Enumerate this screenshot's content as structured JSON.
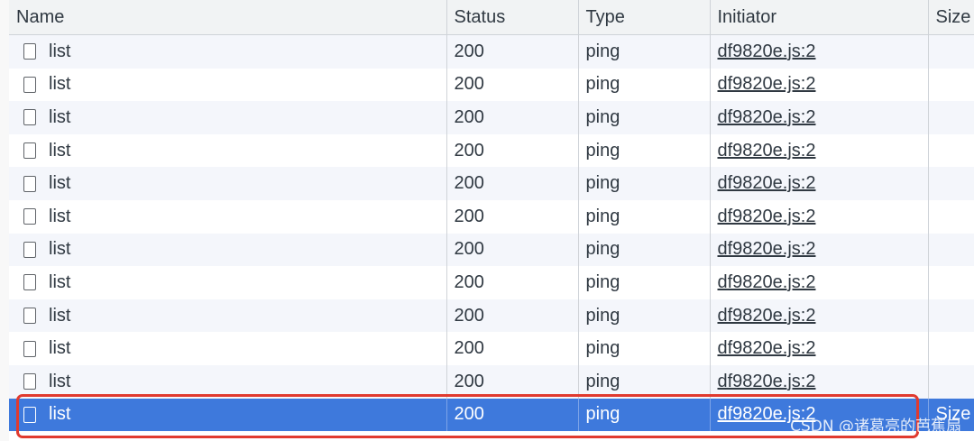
{
  "columns": {
    "name": "Name",
    "status": "Status",
    "type": "Type",
    "initiator": "Initiator",
    "size": "Size"
  },
  "rows": [
    {
      "name": "list",
      "status": "200",
      "type": "ping",
      "initiator": "df9820e.js:2",
      "size": ""
    },
    {
      "name": "list",
      "status": "200",
      "type": "ping",
      "initiator": "df9820e.js:2",
      "size": ""
    },
    {
      "name": "list",
      "status": "200",
      "type": "ping",
      "initiator": "df9820e.js:2",
      "size": ""
    },
    {
      "name": "list",
      "status": "200",
      "type": "ping",
      "initiator": "df9820e.js:2",
      "size": ""
    },
    {
      "name": "list",
      "status": "200",
      "type": "ping",
      "initiator": "df9820e.js:2",
      "size": ""
    },
    {
      "name": "list",
      "status": "200",
      "type": "ping",
      "initiator": "df9820e.js:2",
      "size": ""
    },
    {
      "name": "list",
      "status": "200",
      "type": "ping",
      "initiator": "df9820e.js:2",
      "size": ""
    },
    {
      "name": "list",
      "status": "200",
      "type": "ping",
      "initiator": "df9820e.js:2",
      "size": ""
    },
    {
      "name": "list",
      "status": "200",
      "type": "ping",
      "initiator": "df9820e.js:2",
      "size": ""
    },
    {
      "name": "list",
      "status": "200",
      "type": "ping",
      "initiator": "df9820e.js:2",
      "size": ""
    },
    {
      "name": "list",
      "status": "200",
      "type": "ping",
      "initiator": "df9820e.js:2",
      "size": ""
    },
    {
      "name": "list",
      "status": "200",
      "type": "ping",
      "initiator": "df9820e.js:2",
      "size": "Size"
    }
  ],
  "selected_row_index": 11,
  "watermark": "CSDN @诸葛亮的芭蕉扇",
  "colors": {
    "selected_row": "#3e79dc",
    "highlight_border": "#e03a2f",
    "header_bg": "#f1f3f4",
    "stripe_bg": "#f4f6fb"
  },
  "icons": {
    "row_icon": "document-icon"
  }
}
